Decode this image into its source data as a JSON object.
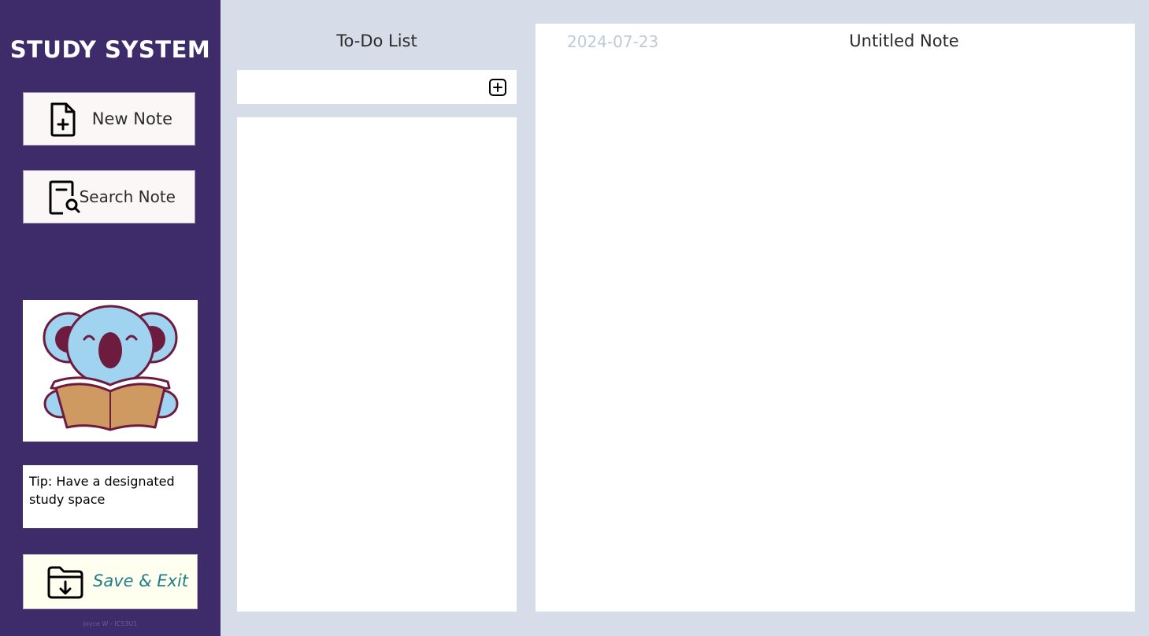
{
  "sidebar": {
    "app_title": "STUDY SYSTEM",
    "new_note_label": "New Note",
    "search_note_label": "Search Note",
    "tip_text": "Tip: Have a designated study space",
    "save_exit_label": "Save & Exit",
    "credit": "Joyce W - ICS3U1",
    "icons": {
      "new_note": "file-plus-icon",
      "search_note": "file-search-icon",
      "save_exit": "folder-download-icon",
      "mascot": "koala-reading-illustration"
    }
  },
  "todo": {
    "title": "To-Do List",
    "input_value": "",
    "add_icon": "plus-square-icon",
    "items": []
  },
  "note": {
    "date": "2024-07-23",
    "title": "Untitled Note",
    "body": ""
  },
  "colors": {
    "sidebar_bg": "#3d2c69",
    "page_bg": "#d6dde9",
    "save_label": "#1f7f84",
    "date_text": "#c0cad6"
  }
}
